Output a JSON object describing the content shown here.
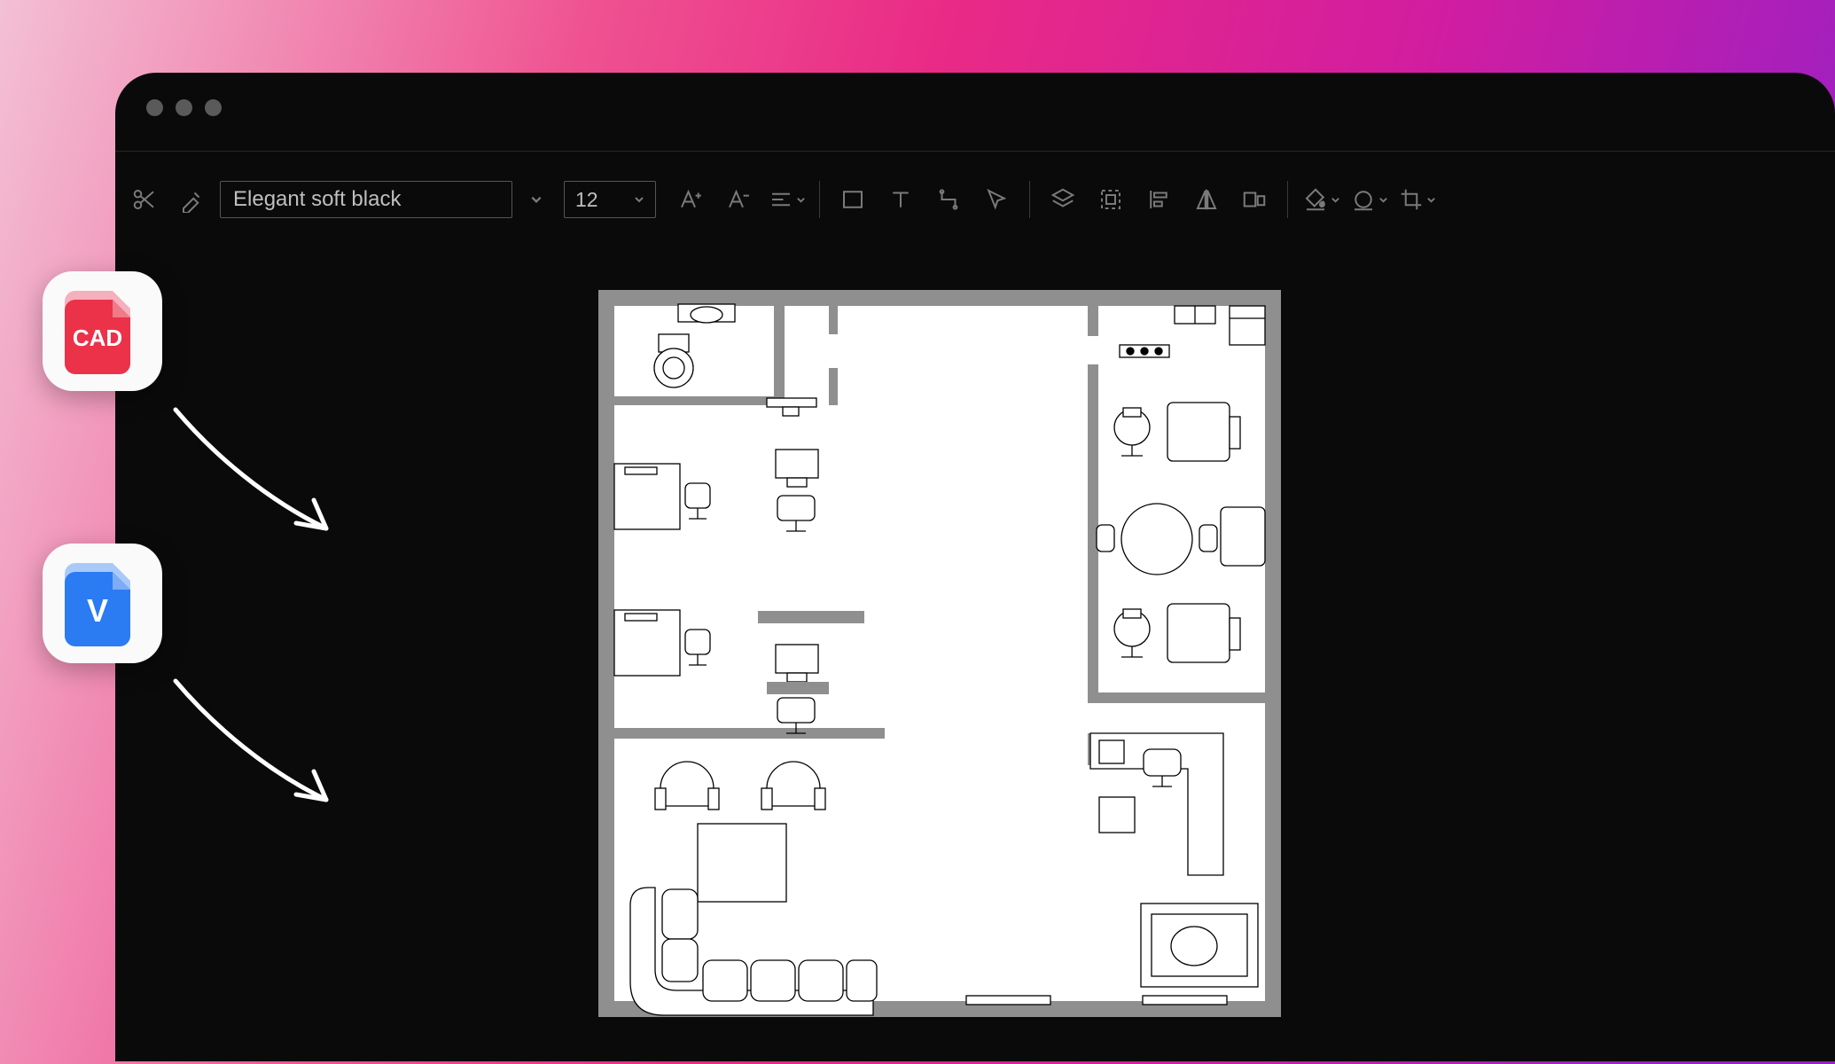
{
  "window": {
    "traffic_lights": 3
  },
  "toolbar": {
    "font_family": "Elegant soft black",
    "font_size": "12",
    "buttons": {
      "cut": "cut",
      "format_painter": "format-painter",
      "font_increase": "A+",
      "font_decrease": "A-",
      "align": "align",
      "rectangle": "rectangle",
      "text": "text",
      "connector": "connector",
      "pointer": "pointer",
      "layers": "layers",
      "group": "group",
      "align_left": "align-left",
      "flip_h": "flip-horizontal",
      "same_size": "same-size",
      "fill": "fill",
      "line_style": "line-style",
      "crop": "crop"
    }
  },
  "file_badges": {
    "cad": {
      "label": "CAD",
      "color": "#eb3249"
    },
    "visio": {
      "label": "V",
      "color": "#2b7bf3"
    }
  },
  "canvas": {
    "diagram_type": "office-floor-plan",
    "background": "#ffffff",
    "wall_color": "#8f8f8f",
    "rooms": [
      "bathroom",
      "open-office-left",
      "open-office-right",
      "lounge",
      "reception",
      "manager-office"
    ],
    "furniture": [
      "toilet",
      "sink",
      "desk",
      "office-chair",
      "round-table",
      "sofa-sectional",
      "coffee-table",
      "armchair",
      "reception-desk",
      "rug",
      "monitor",
      "plant"
    ]
  }
}
